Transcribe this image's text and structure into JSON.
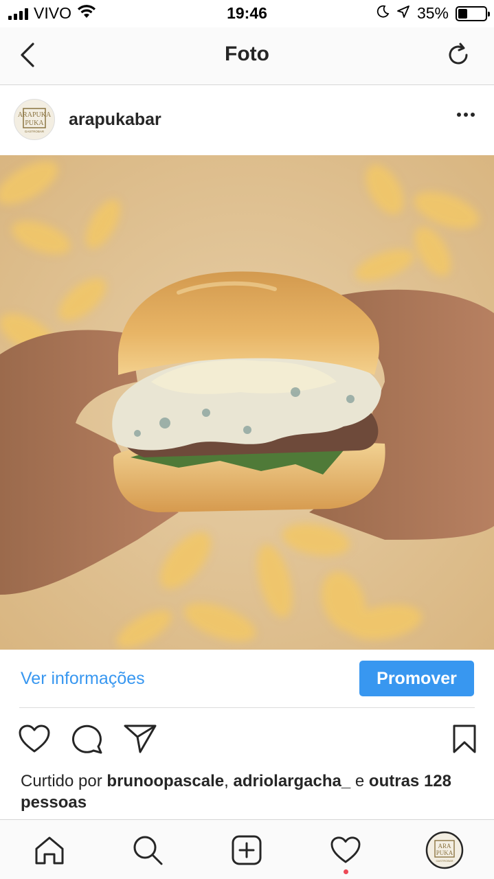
{
  "status_bar": {
    "carrier": "VIVO",
    "time": "19:46",
    "battery_percent": "35%",
    "battery_level": 0.35
  },
  "nav": {
    "title": "Foto",
    "back_icon": "chevron-left-icon",
    "refresh_icon": "refresh-icon"
  },
  "post": {
    "username": "arapukabar",
    "avatar_logo_text": "ARAPUKA",
    "avatar_logo_sub": "GASTROBAR",
    "image_description_icon": "photo"
  },
  "promote": {
    "info_link": "Ver informações",
    "promote_button": "Promover",
    "accent_color": "#3897f0"
  },
  "likes": {
    "prefix": "Curtido por",
    "user1": "brunoopascale",
    "separator": ",",
    "user2": "adriolargacha_",
    "conjunction": "e",
    "others": "outras 128 pessoas"
  },
  "tab_bar": {
    "items": [
      "home-icon",
      "search-icon",
      "add-post-icon",
      "activity-heart-icon",
      "profile-avatar"
    ],
    "notification_color": "#ed4956"
  }
}
